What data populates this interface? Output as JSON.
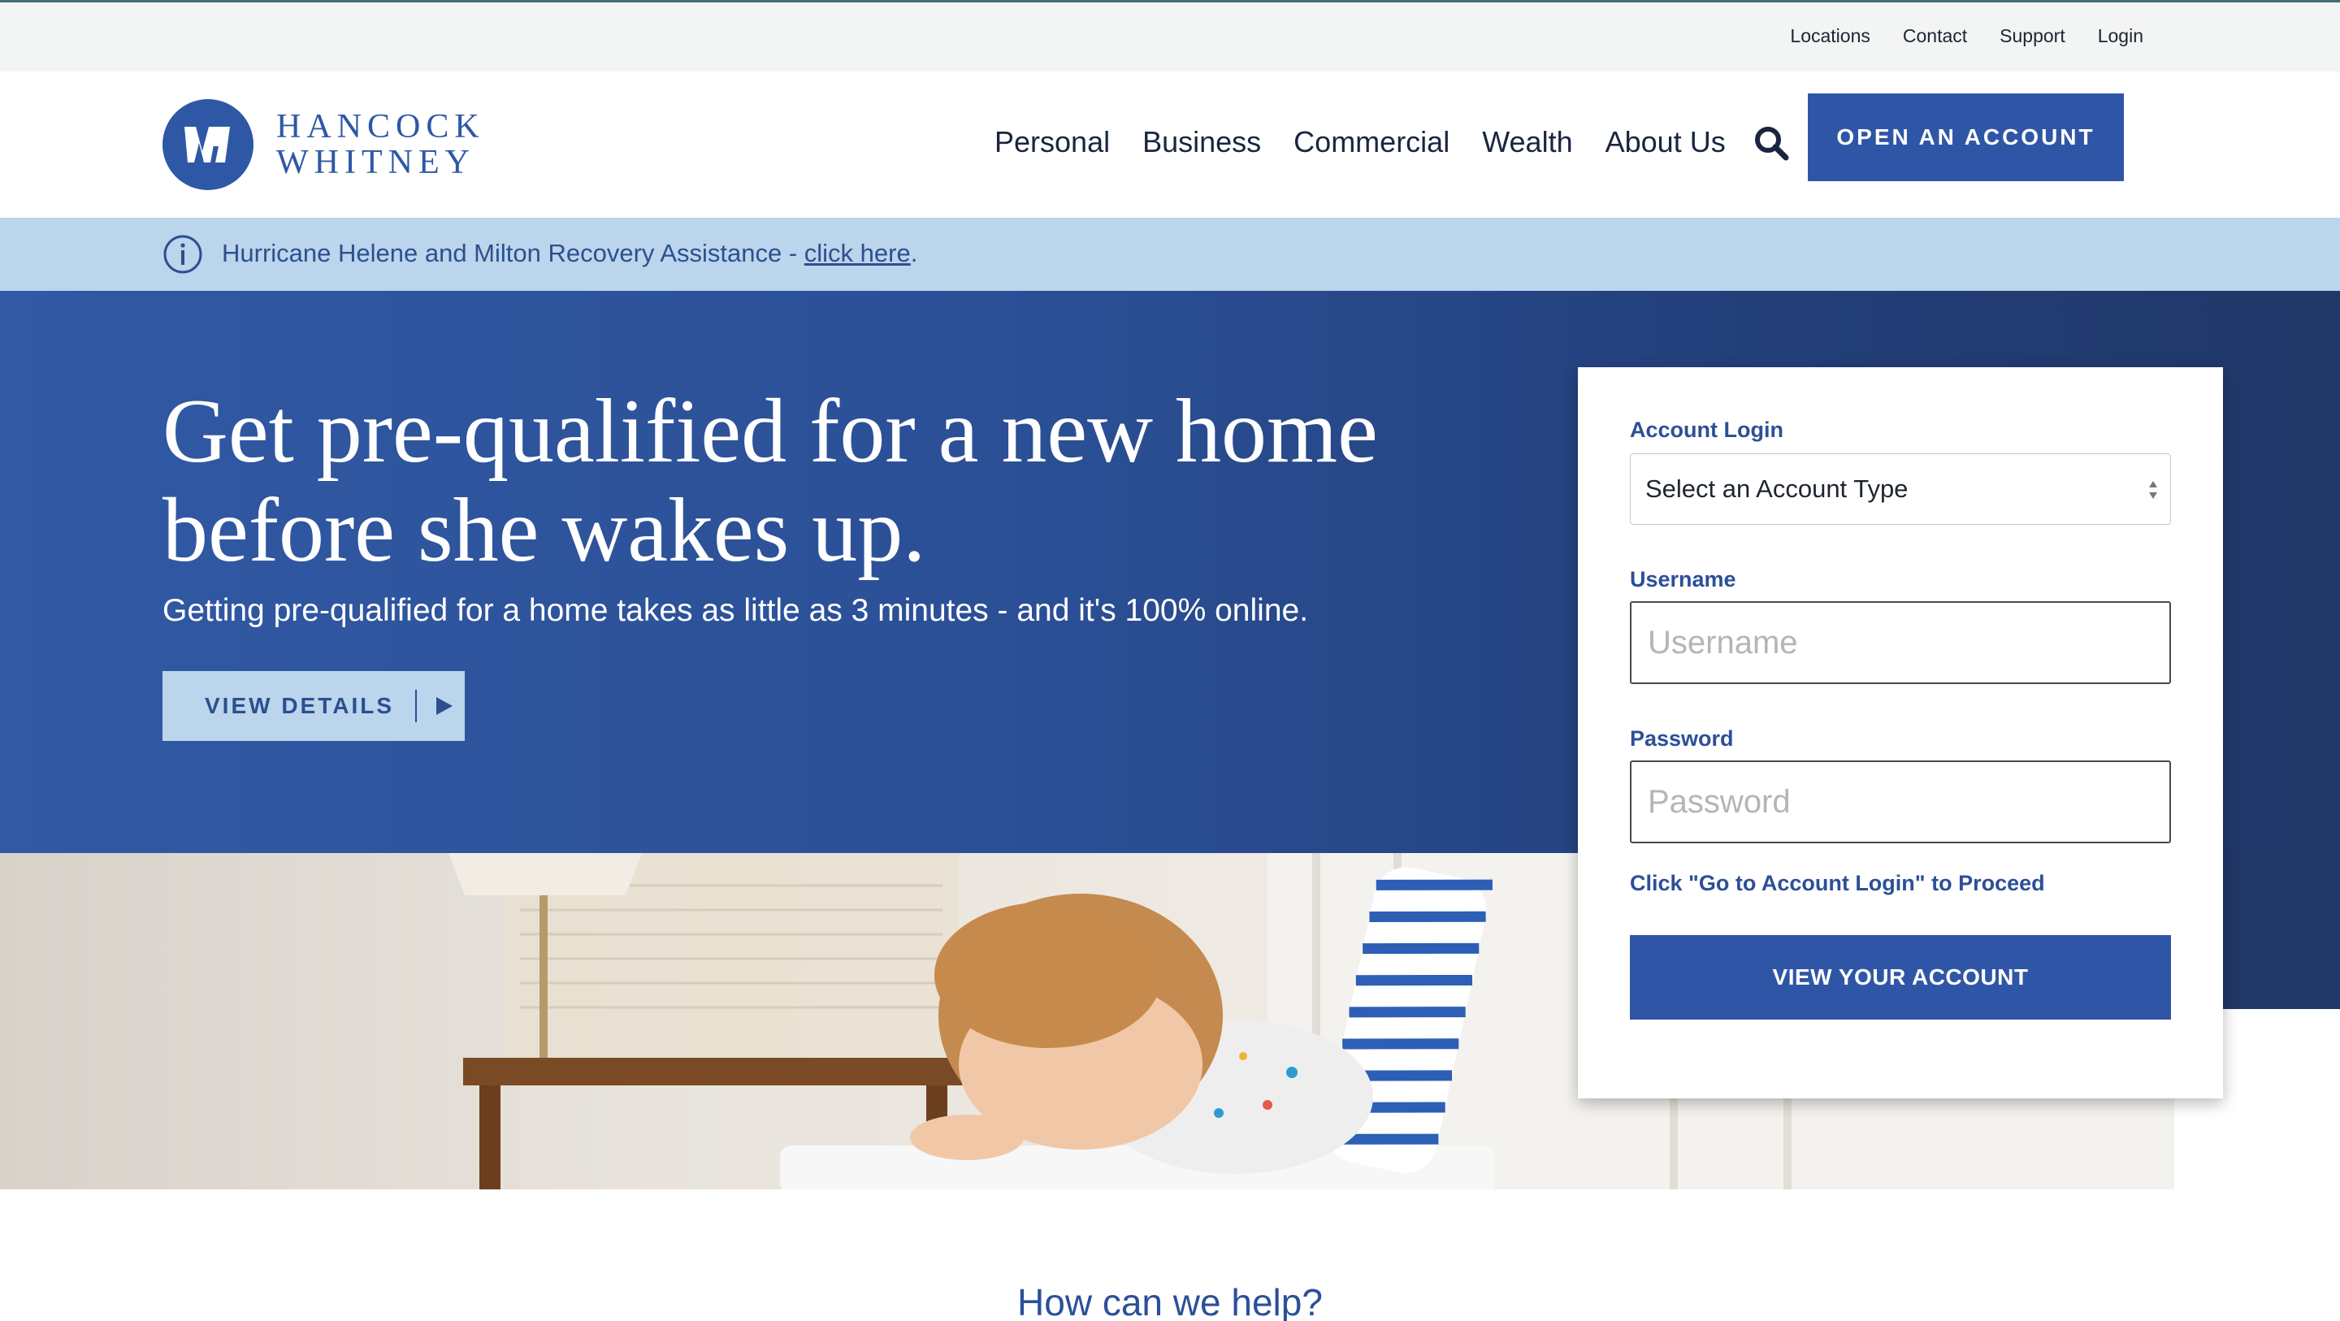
{
  "utility": {
    "links": [
      "Locations",
      "Contact",
      "Support",
      "Login"
    ]
  },
  "brand": {
    "line1": "HANCOCK",
    "line2": "WHITNEY",
    "color": "#2e58a6"
  },
  "nav": {
    "items": [
      "Personal",
      "Business",
      "Commercial",
      "Wealth",
      "About Us"
    ],
    "search_icon": "search-icon",
    "cta_label": "OPEN AN ACCOUNT"
  },
  "alert": {
    "icon": "info-icon",
    "text": "Hurricane Helene and Milton Recovery Assistance - ",
    "link_label": "click here",
    "trailing": "."
  },
  "hero": {
    "title": "Get pre-qualified for a new home before she wakes up.",
    "subtitle": "Getting pre-qualified for a home takes as little as 3 minutes - and it's 100% online.",
    "button_label": "VIEW DETAILS",
    "button_icon": "play-arrow-icon"
  },
  "login": {
    "heading": "Account Login",
    "select_value": "Select an Account Type",
    "username_label": "Username",
    "username_placeholder": "Username",
    "password_label": "Password",
    "password_placeholder": "Password",
    "hint": "Click \"Go to Account Login\" to Proceed",
    "submit_label": "VIEW YOUR ACCOUNT"
  },
  "help": {
    "title": "How can we help?"
  },
  "colors": {
    "primary": "#2f56a6",
    "hero_dark": "#203767",
    "alert_bg": "#bad5ec"
  }
}
